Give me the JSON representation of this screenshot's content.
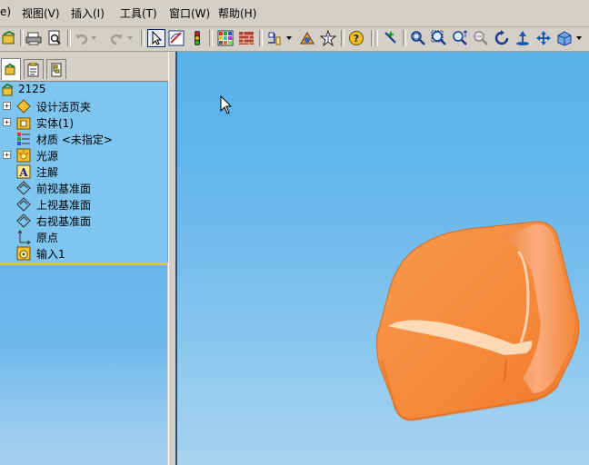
{
  "menu": {
    "items": [
      "e)",
      "视图(V)",
      "插入(I)",
      "工具(T)",
      "窗口(W)",
      "帮助(H)"
    ]
  },
  "toolbar": {
    "icons": [
      "rebuild-icon",
      "print-icon",
      "print-preview-icon",
      "undo-icon",
      "redo-icon",
      "select-icon",
      "sketch-icon",
      "traffic-light-icon",
      "grid-icon",
      "brick-icon",
      "dimension-icon",
      "smart-icon",
      "star-icon",
      "help-icon",
      "magnet-icon",
      "zoom-fit-icon",
      "zoom-area-icon",
      "zoom-in-out-icon",
      "zoom-select-icon",
      "rotate-icon",
      "pan-up-icon",
      "pan-icon",
      "view-orient-icon"
    ]
  },
  "tree": {
    "root": "2125",
    "items": [
      {
        "label": "设计活页夹",
        "icon": "binder-icon",
        "expand": "+"
      },
      {
        "label": "实体(1)",
        "icon": "solid-body-icon",
        "expand": "+"
      },
      {
        "label": "材质 <未指定>",
        "icon": "material-icon",
        "expand": ""
      },
      {
        "label": "光源",
        "icon": "lights-icon",
        "expand": "+"
      },
      {
        "label": "注解",
        "icon": "annotation-icon",
        "expand": ""
      },
      {
        "label": "前视基准面",
        "icon": "plane-icon",
        "expand": ""
      },
      {
        "label": "上视基准面",
        "icon": "plane-icon",
        "expand": ""
      },
      {
        "label": "右视基准面",
        "icon": "plane-icon",
        "expand": ""
      },
      {
        "label": "原点",
        "icon": "origin-icon",
        "expand": ""
      },
      {
        "label": "输入1",
        "icon": "import-icon",
        "expand": ""
      }
    ]
  },
  "colors": {
    "tree_bg": "#7ec5ef",
    "viewport_top": "#5ab2ea",
    "viewport_bottom": "#a8d2ef",
    "part": "#f88a3c"
  }
}
